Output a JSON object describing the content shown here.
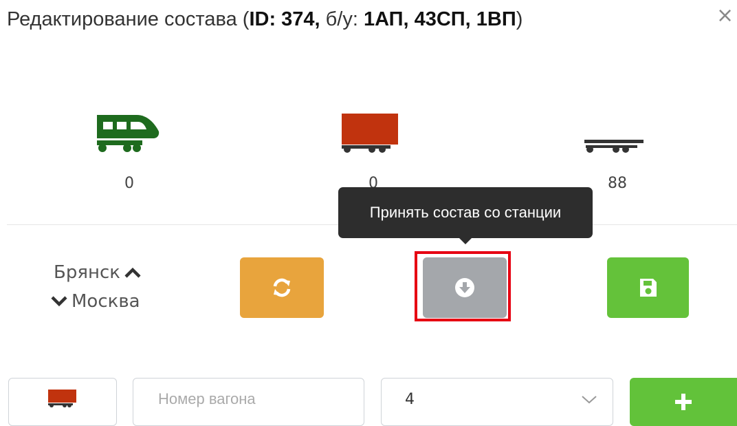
{
  "dialog": {
    "title_prefix": "Редактирование состава (",
    "id_label": "ID: 374,",
    "bu_label": " б/у: ",
    "bu_values": "1АП, 43СП, 1ВП",
    "title_suffix": ")"
  },
  "counters": {
    "locomotive": "0",
    "wagon": "0",
    "platform": "88"
  },
  "route": {
    "from": "Брянск",
    "to": "Москва"
  },
  "tooltip": {
    "text": "Принять состав со станции"
  },
  "bottom_row": {
    "wagon_number_placeholder": "Номер вагона",
    "select_value": "4"
  },
  "colors": {
    "locomotive": "#1e6b1e",
    "wagon": "#c1330e",
    "platform": "#333333",
    "orange": "#e8a43d",
    "gray": "#a4a7ab",
    "green": "#64c23a",
    "highlight": "#e60012"
  },
  "icons": {
    "close": "close-icon",
    "locomotive": "locomotive-icon",
    "wagon": "wagon-icon",
    "platform": "platform-car-icon",
    "refresh": "refresh-icon",
    "download": "arrow-circle-down-icon",
    "save": "save-icon",
    "chevron_up": "chevron-up-icon",
    "chevron_down": "chevron-down-icon",
    "plus": "plus-icon"
  }
}
